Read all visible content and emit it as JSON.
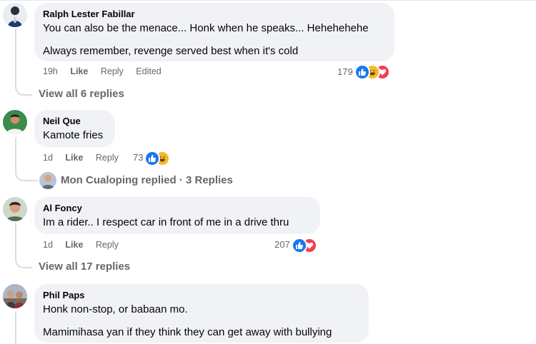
{
  "comments": [
    {
      "name": "Ralph Lester Fabillar",
      "lines": [
        "You can also be the menace... Honk when he speaks... Hehehehehe",
        "Always remember, revenge served best when it's cold"
      ],
      "time": "19h",
      "like": "Like",
      "reply": "Reply",
      "edited": "Edited",
      "reaction_count": "179",
      "view_replies": "View all 6 replies"
    },
    {
      "name": "Neil Que",
      "lines": [
        "Kamote fries"
      ],
      "time": "1d",
      "like": "Like",
      "reply": "Reply",
      "reaction_count": "73",
      "replied_summary": "Mon Cualoping replied · 3 Replies"
    },
    {
      "name": "Al Foncy",
      "lines": [
        "Im a rider.. I respect car in front of me in a drive thru"
      ],
      "time": "1d",
      "like": "Like",
      "reply": "Reply",
      "reaction_count": "207",
      "view_replies": "View all 17 replies"
    },
    {
      "name": "Phil Paps",
      "lines": [
        "Honk non-stop, or babaan mo.",
        "Mamimihasa yan if they think they can get away with bullying"
      ]
    }
  ],
  "icons": {
    "like": "thumbs-up-icon",
    "love": "heart-icon",
    "haha": "laugh-icon"
  },
  "colors": {
    "like": "#1877f2",
    "love": "#f33e58",
    "haha": "#f7b928",
    "bubble": "#f0f2f5",
    "meta": "#65676b"
  }
}
